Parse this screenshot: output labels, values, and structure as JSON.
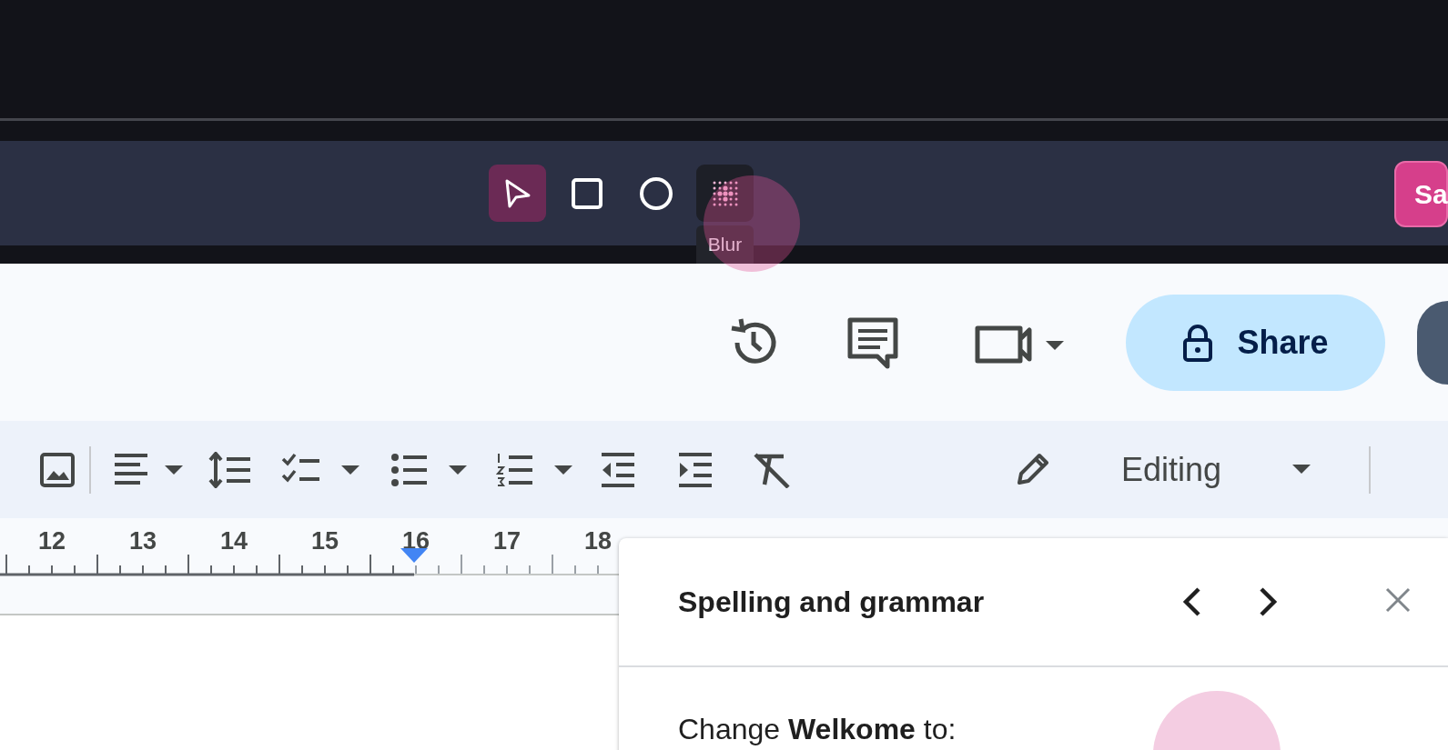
{
  "capture_toolbar": {
    "tools": [
      {
        "kind": "select",
        "selected": true,
        "hovered": false
      },
      {
        "kind": "rectangle",
        "selected": false,
        "hovered": false
      },
      {
        "kind": "ellipse",
        "selected": false,
        "hovered": false
      },
      {
        "kind": "blur",
        "selected": false,
        "hovered": true
      }
    ],
    "tooltip": "Blur",
    "save_button": "Sa"
  },
  "docs_header": {
    "share_button": "Share"
  },
  "format_toolbar": {
    "mode": "Editing"
  },
  "ruler": {
    "labels": [
      "12",
      "13",
      "14",
      "15",
      "16",
      "17",
      "18"
    ]
  },
  "spelling_panel": {
    "title": "Spelling and grammar",
    "suggestion": "Change **Welkome** to:"
  }
}
